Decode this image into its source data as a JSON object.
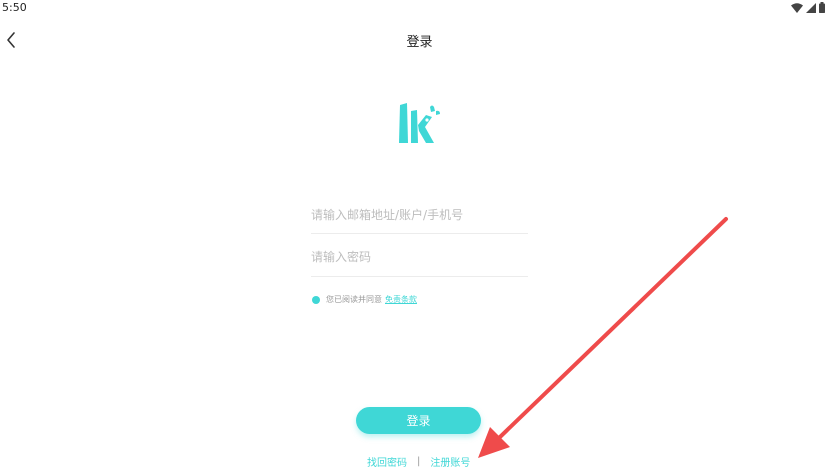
{
  "status_bar": {
    "time": "5:50",
    "icons": [
      "wifi-icon",
      "signal-icon",
      "battery-icon"
    ]
  },
  "header": {
    "back_icon": "chevron-left-icon",
    "title": "登录"
  },
  "logo": {
    "icon": "lk-logo"
  },
  "form": {
    "account_placeholder": "请输入邮箱地址/账户/手机号",
    "account_value": "",
    "password_placeholder": "请输入密码",
    "password_value": ""
  },
  "agreement": {
    "checked": true,
    "text": "您已阅读并同意",
    "link": "免责条款"
  },
  "actions": {
    "login_label": "登录",
    "forgot_password": "找回密码",
    "separator": "|",
    "register": "注册账号"
  },
  "colors": {
    "accent": "#3fd7d6",
    "annotation_arrow": "#ef4b4b"
  }
}
